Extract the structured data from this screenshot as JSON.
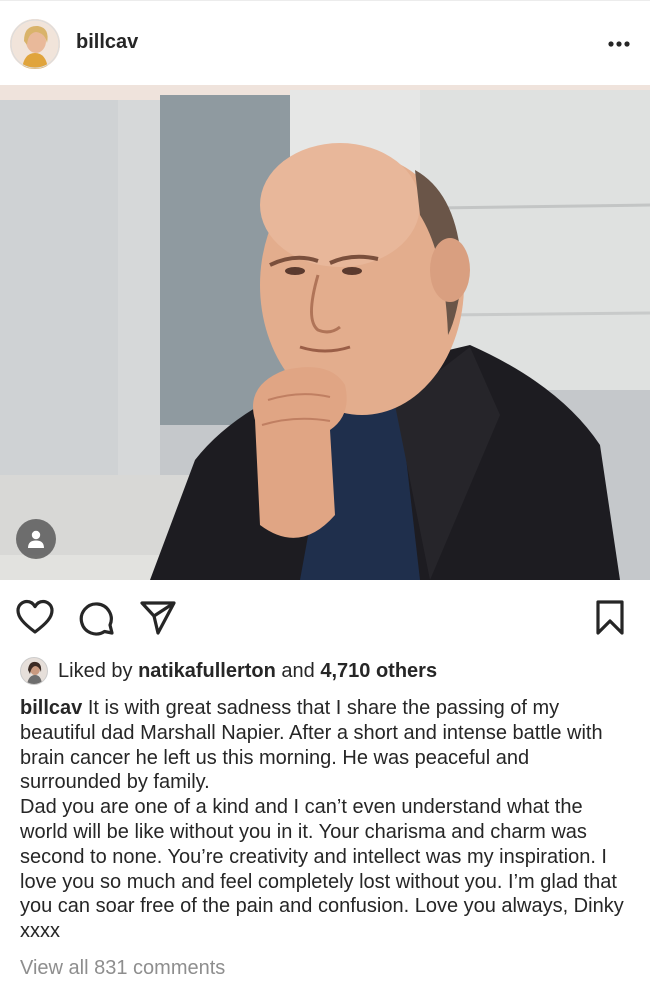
{
  "post": {
    "username": "billcav",
    "more_icon": "more-options-icon"
  },
  "actions": {
    "like_icon": "heart-icon",
    "comment_icon": "comment-icon",
    "share_icon": "share-icon",
    "save_icon": "bookmark-icon"
  },
  "likes": {
    "prefix": "Liked by ",
    "liker": "natikafullerton",
    "connector": " and ",
    "count": "4,710 others"
  },
  "caption": {
    "user": "billcav",
    "paragraph1": "It is with great sadness that I share the passing of my beautiful dad Marshall Napier. After a short and intense battle with brain cancer he left us this morning. He was peaceful and surrounded by family.",
    "paragraph2": "Dad you are one of a kind and I can’t even understand what the world will be like without you in it. Your charisma and charm was second to none. You’re creativity and intellect was my inspiration. I love you so much and feel completely lost without you. I’m glad that you can soar free of the pain and confusion. Love you always, Dinky xxxx"
  },
  "comments": {
    "view_all": "View all 831 comments"
  },
  "next_comment": {
    "user": "",
    "text": ""
  }
}
